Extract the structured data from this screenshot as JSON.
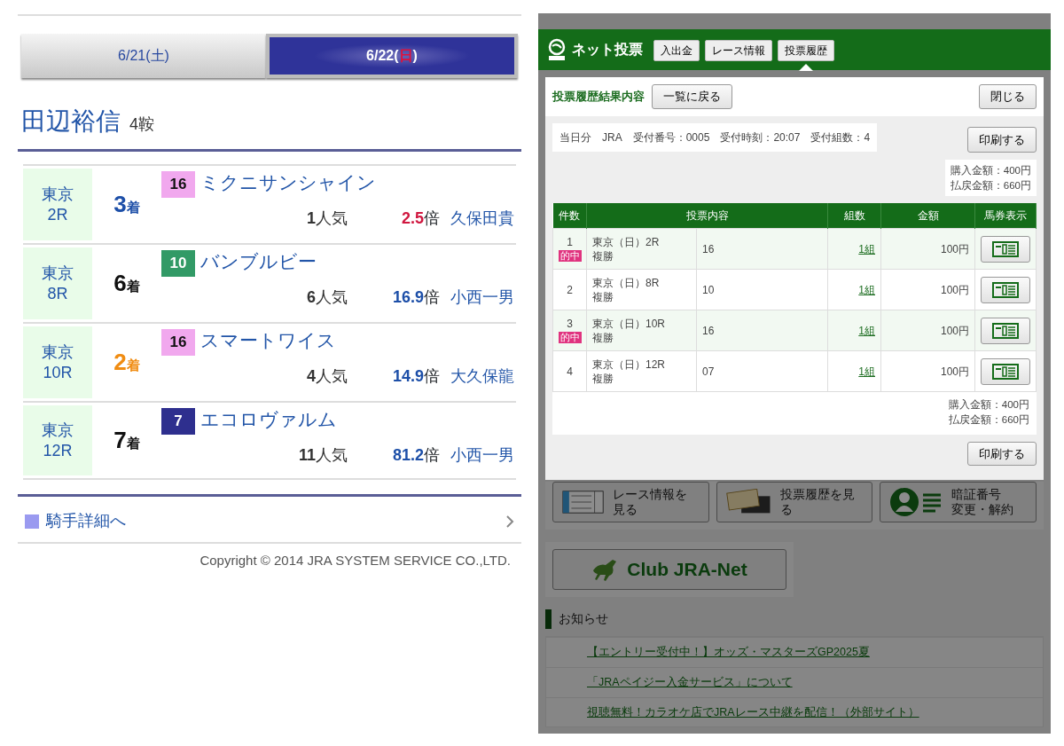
{
  "results_page": {
    "date_tabs": [
      {
        "label_parts": [
          "6/21(",
          "土",
          ")"
        ],
        "holiday": false,
        "selected": false
      },
      {
        "label_parts": [
          "6/22(",
          "日",
          ")"
        ],
        "holiday": true,
        "selected": true
      }
    ],
    "jockey": {
      "name": "田辺裕信",
      "mounts": "4鞍"
    },
    "races": [
      {
        "course": "東京",
        "race": "2R",
        "place": "3",
        "place_unit": "着",
        "color": "#1d4fa8",
        "horse": {
          "number": "16",
          "color": "#f1a8ee",
          "name": "ミクニサンシャイン"
        },
        "popularity": "1",
        "popularity_unit": "人気",
        "odds": {
          "value": "2.5",
          "unit": "倍",
          "color": "#d0173f"
        },
        "rider": "久保田貴"
      },
      {
        "course": "東京",
        "race": "8R",
        "place": "6",
        "place_unit": "着",
        "color": "#111111",
        "horse": {
          "number": "10",
          "color": "#329a66",
          "name": "バンブルビー"
        },
        "popularity": "6",
        "popularity_unit": "人気",
        "odds": {
          "value": "16.9",
          "unit": "倍",
          "color": "#1d4fa8"
        },
        "rider": "小西一男"
      },
      {
        "course": "東京",
        "race": "10R",
        "place": "2",
        "place_unit": "着",
        "color": "#f08c12",
        "horse": {
          "number": "16",
          "color": "#f1a8ee",
          "name": "スマートワイス"
        },
        "popularity": "4",
        "popularity_unit": "人気",
        "odds": {
          "value": "14.9",
          "unit": "倍",
          "color": "#1d4fa8"
        },
        "rider": "大久保龍"
      },
      {
        "course": "東京",
        "race": "12R",
        "place": "7",
        "place_unit": "着",
        "color": "#111111",
        "horse": {
          "number": "7",
          "color": "#2e2f8e",
          "name": "エコロヴァルム"
        },
        "popularity": "11",
        "popularity_unit": "人気",
        "odds": {
          "value": "81.2",
          "unit": "倍",
          "color": "#1d4fa8"
        },
        "rider": "小西一男"
      }
    ],
    "detail_link": "騎手詳細へ",
    "copyright": "Copyright © 2014 JRA SYSTEM SERVICE CO.,LTD."
  },
  "net_vote": {
    "logo_text": "ネット投票",
    "nav": [
      {
        "label": "入出金",
        "selected": false
      },
      {
        "label": "レース情報",
        "selected": false
      },
      {
        "label": "投票履歴",
        "selected": true
      }
    ],
    "dialog": {
      "title": "投票履歴結果内容",
      "back_button": "一覧に戻る",
      "close_button": "閉じる",
      "receipt_info": [
        "当日分",
        "JRA",
        "受付番号：0005",
        "受付時刻：20:07",
        "受付組数：4"
      ],
      "print_button": "印刷する",
      "totals": [
        "購入金額：400円",
        "払戻金額：660円"
      ],
      "columns": [
        "件数",
        "投票内容",
        "組数",
        "金額",
        "馬券表示"
      ],
      "rows": [
        {
          "no": "1",
          "badge": "的中",
          "race": "東京（日）2R",
          "bet_type": "複勝",
          "selection": "16",
          "combos": "1組",
          "amount": "100円"
        },
        {
          "no": "2",
          "race": "東京（日）8R",
          "bet_type": "複勝",
          "selection": "10",
          "combos": "1組",
          "amount": "100円"
        },
        {
          "no": "3",
          "badge": "的中",
          "race": "東京（日）10R",
          "bet_type": "複勝",
          "selection": "16",
          "combos": "1組",
          "amount": "100円"
        },
        {
          "no": "4",
          "race": "東京（日）12R",
          "bet_type": "複勝",
          "selection": "07",
          "combos": "1組",
          "amount": "100円"
        }
      ],
      "footer_totals": [
        "購入金額：400円",
        "払戻金額：660円"
      ],
      "footer_print_button": "印刷する"
    },
    "menu_tiles": [
      {
        "kind": "race",
        "lines": [
          "レース情報を見る"
        ]
      },
      {
        "kind": "history",
        "lines": [
          "投票履歴を見る"
        ]
      },
      {
        "kind": "account",
        "lines": [
          "暗証番号",
          "変更・解約"
        ]
      }
    ],
    "club_banner": "Club JRA-Net",
    "notices_heading": "お知らせ",
    "notices": [
      "【エントリー受付中！】オッズ・マスターズGP2025夏",
      "「JRAペイジー入金サービス」について",
      "視聴無料！カラオケ店でJRAレース中継を配信！（外部サイト）"
    ]
  }
}
